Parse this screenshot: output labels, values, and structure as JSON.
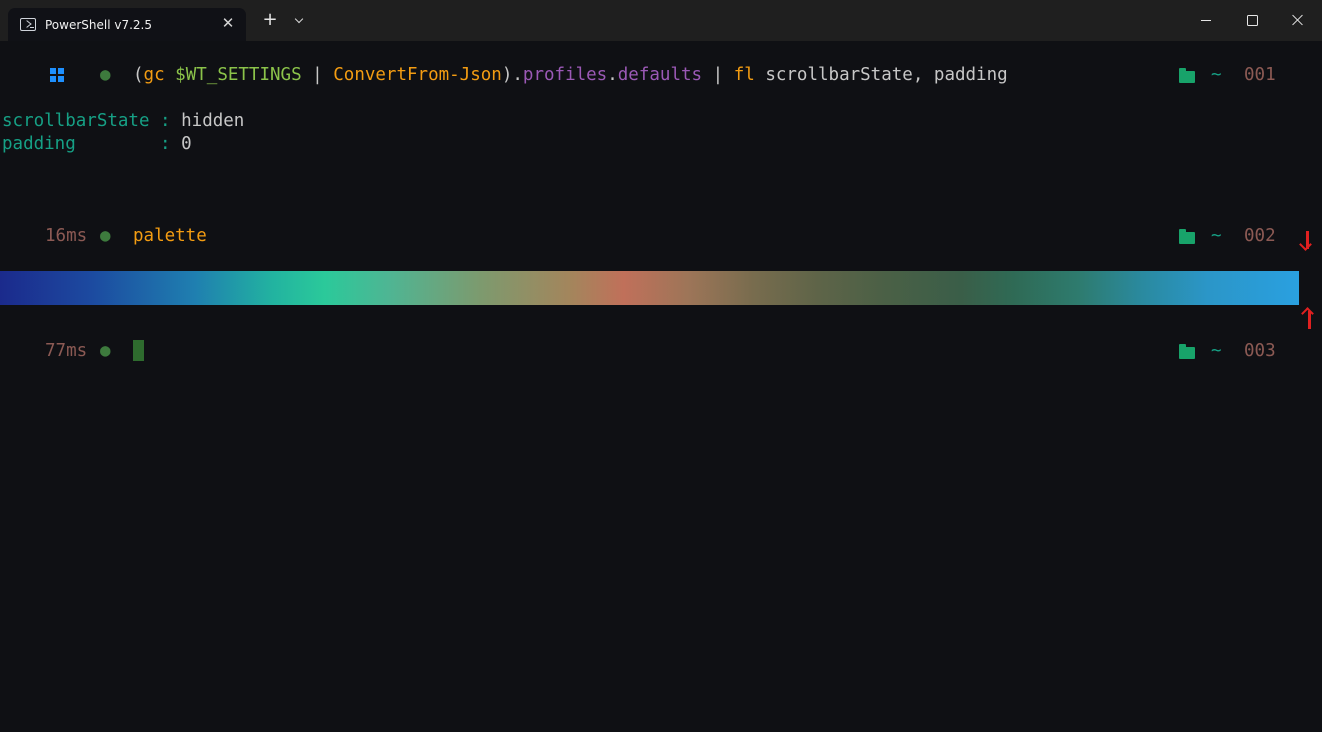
{
  "window": {
    "tab_title": "PowerShell v7.2.5",
    "new_tab_symbol": "+",
    "close_tab_symbol": "✕"
  },
  "prompts": [
    {
      "left_segment": "windows-logo-icon",
      "status_dot": "●",
      "command": {
        "open_paren": "(",
        "gc": "gc",
        "var": "$WT_SETTINGS",
        "pipe1": "|",
        "cmdlet": "ConvertFrom-Json",
        "close_paren": ")",
        "dot1": ".",
        "prop1": "profiles",
        "dot2": ".",
        "prop2": "defaults",
        "pipe2": "|",
        "fl": "fl",
        "args": "scrollbarState, padding"
      },
      "right": {
        "tilde": "~",
        "index": "001"
      }
    },
    {
      "duration": "16ms",
      "status_dot": "●",
      "command_text": "palette",
      "right": {
        "tilde": "~",
        "index": "002"
      }
    },
    {
      "duration": "77ms",
      "status_dot": "●",
      "right": {
        "tilde": "~",
        "index": "003"
      }
    }
  ],
  "output": [
    {
      "key": "scrollbarState",
      "sep": " : ",
      "value": "hidden"
    },
    {
      "key": "padding       ",
      "sep": " : ",
      "value": "0"
    }
  ],
  "colors": {
    "accent_green": "#27ae60",
    "folder_green": "#18a36a",
    "annotation_red": "#e02020"
  }
}
